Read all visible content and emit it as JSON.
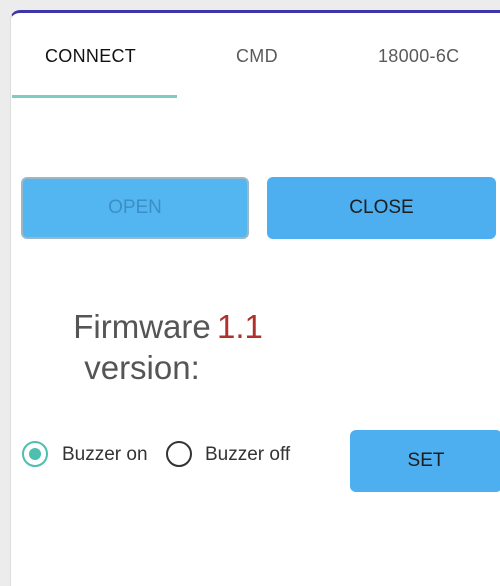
{
  "tabs": [
    {
      "label": "CONNECT",
      "selected": true
    },
    {
      "label": "CMD",
      "selected": false
    },
    {
      "label": "18000-6C",
      "selected": false
    }
  ],
  "buttons": {
    "open": "OPEN",
    "close": "CLOSE",
    "set": "SET"
  },
  "firmware": {
    "label_line1": "Firmware",
    "label_line2": "version:",
    "value": "1.1"
  },
  "buzzer": {
    "on_label": "Buzzer on",
    "off_label": "Buzzer off",
    "selected": "on"
  },
  "colors": {
    "accent": "#4daef0",
    "tab_indicator": "#80cbc4",
    "radio_selected": "#4cbfae",
    "firmware_value": "#b0302c",
    "window_top_border": "#3d35a8"
  }
}
